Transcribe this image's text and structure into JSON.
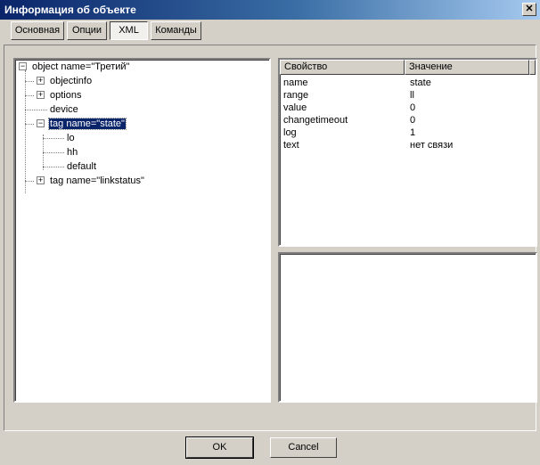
{
  "window": {
    "title": "Информация об объекте",
    "close_glyph": "✕"
  },
  "tabs": [
    {
      "label": "Основная",
      "active": false
    },
    {
      "label": "Опции",
      "active": false
    },
    {
      "label": "XML",
      "active": true
    },
    {
      "label": "Команды",
      "active": false
    }
  ],
  "tree": {
    "root": "object name=\"Третий\"",
    "items": [
      {
        "label": "objectinfo",
        "expander": "+"
      },
      {
        "label": "options",
        "expander": "+"
      },
      {
        "label": "device",
        "expander": ""
      },
      {
        "label": "tag name=\"state\"",
        "expander": "−",
        "selected": true
      },
      {
        "label": "lo",
        "expander": ""
      },
      {
        "label": "hh",
        "expander": ""
      },
      {
        "label": "default",
        "expander": ""
      },
      {
        "label": "tag name=\"linkstatus\"",
        "expander": "+"
      }
    ]
  },
  "properties": {
    "columns": [
      "Свойство",
      "Значение"
    ],
    "rows": [
      {
        "name": "name",
        "value": "state"
      },
      {
        "name": "range",
        "value": "ll"
      },
      {
        "name": "value",
        "value": "0"
      },
      {
        "name": "changetimeout",
        "value": "0"
      },
      {
        "name": "log",
        "value": "1"
      },
      {
        "name": "text",
        "value": "нет связи"
      }
    ]
  },
  "buttons": {
    "ok": "OK",
    "cancel": "Cancel"
  }
}
